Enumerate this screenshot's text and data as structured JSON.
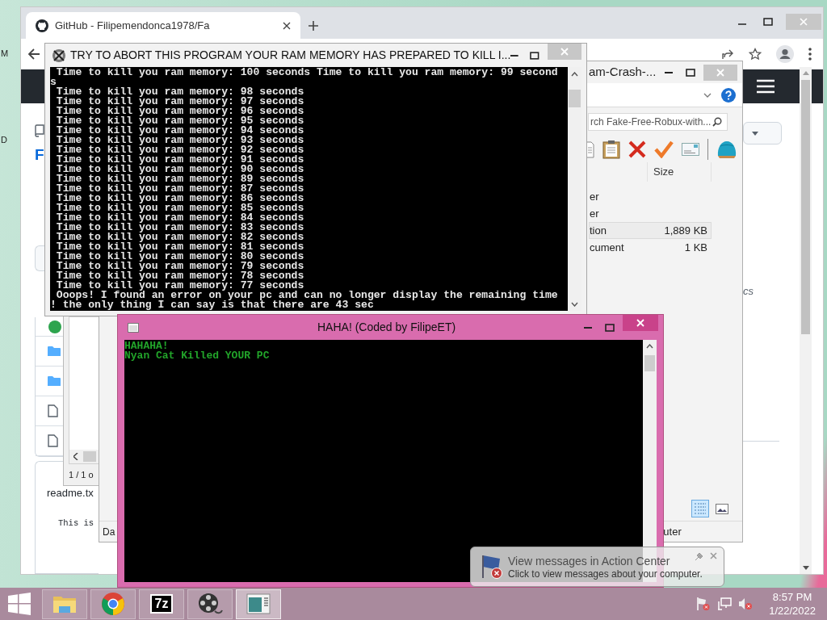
{
  "desktop": {
    "icon_labels": [
      "M",
      "D"
    ]
  },
  "browser": {
    "tab": {
      "title": "GitHub - Filipemendonca1978/Fa",
      "selected": true
    },
    "page": {
      "repo_initial": "F",
      "file_rows": [
        {
          "kind": "status"
        },
        {
          "kind": "folder"
        },
        {
          "kind": "folder"
        },
        {
          "kind": "file"
        },
        {
          "kind": "file"
        }
      ],
      "readme_title": "readme.tx",
      "readme_text": "This is",
      "side_text": "cs"
    }
  },
  "viewer": {
    "page_count": "1 / 1 o"
  },
  "explorer": {
    "title": "am-Crash-...",
    "search_placeholder": "rch Fake-Free-Robux-with...",
    "columns": [
      "Size"
    ],
    "rows": [
      {
        "column_1": "er",
        "selected": false
      },
      {
        "column_1": "er",
        "selected": false
      },
      {
        "column_1": "tion",
        "size": "1,889 KB",
        "selected": true
      },
      {
        "column_1": "cument",
        "size": "1 KB",
        "selected": false
      }
    ],
    "view_buttons": [
      {
        "kind": "details",
        "selected": true
      },
      {
        "kind": "preview",
        "selected": false
      }
    ],
    "status_left": "Da",
    "status_right": "uter"
  },
  "console": {
    "title": "TRY TO ABORT THIS PROGRAM YOUR RAM MEMORY HAS PREPARED TO KILL I...",
    "lines": [
      " Time to kill you ram memory: 100 seconds Time to kill you ram memory: 99 second",
      "s",
      " Time to kill you ram memory: 98 seconds",
      " Time to kill you ram memory: 97 seconds",
      " Time to kill you ram memory: 96 seconds",
      " Time to kill you ram memory: 95 seconds",
      " Time to kill you ram memory: 94 seconds",
      " Time to kill you ram memory: 93 seconds",
      " Time to kill you ram memory: 92 seconds",
      " Time to kill you ram memory: 91 seconds",
      " Time to kill you ram memory: 90 seconds",
      " Time to kill you ram memory: 89 seconds",
      " Time to kill you ram memory: 87 seconds",
      " Time to kill you ram memory: 86 seconds",
      " Time to kill you ram memory: 85 seconds",
      " Time to kill you ram memory: 84 seconds",
      " Time to kill you ram memory: 83 seconds",
      " Time to kill you ram memory: 82 seconds",
      " Time to kill you ram memory: 81 seconds",
      " Time to kill you ram memory: 80 seconds",
      " Time to kill you ram memory: 79 seconds",
      " Time to kill you ram memory: 78 seconds",
      " Time to kill you ram memory: 77 seconds",
      " Ooops! I found an error on your pc and can no longer display the remaining time",
      "! the only thing I can say is that there are 43 sec"
    ]
  },
  "message_window": {
    "title": "HAHA! (Coded by FilipeET)",
    "lines": [
      "HAHAHA!",
      "Nyan Cat Killed YOUR PC"
    ]
  },
  "notification": {
    "title": "View messages in Action Center",
    "text": "Click to view messages about your computer."
  },
  "taskbar": {
    "apps": [
      {
        "kind": "folder",
        "selected": false
      },
      {
        "kind": "chrome",
        "selected": false
      },
      {
        "kind": "sevenzip",
        "label": "7z",
        "selected": false
      },
      {
        "kind": "film",
        "selected": false
      },
      {
        "kind": "console",
        "selected": true
      }
    ],
    "clock": {
      "time": "8:57 PM",
      "date": "1/22/2022"
    }
  }
}
